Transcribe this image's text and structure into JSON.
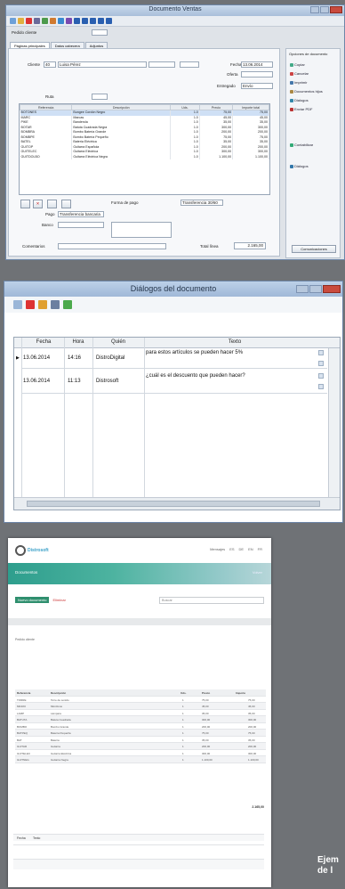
{
  "win1": {
    "title": "Documento Ventas",
    "toolbar_icons": [
      "new-icon",
      "open-icon",
      "save-icon",
      "delete-icon",
      "print-icon",
      "copy-icon",
      "mail-icon",
      "chart-icon",
      "calc-icon",
      "grid-icon",
      "blue-box-icon",
      "blue-box-icon",
      "blue-box-icon",
      "blue-box-icon"
    ],
    "customer_label": "Pedido cliente",
    "tabs": [
      "Páginas principales",
      "Datos cabecera",
      "Adjuntos"
    ],
    "client_label": "Cliente",
    "client_code": "40",
    "client_name": "Luisa Pérez",
    "fecha_label": "Fecha",
    "fecha_value": "13.06.2014",
    "oferta_label": "Oferta",
    "entregado_label": "Entregado",
    "entregado_value": "Envío",
    "ruta_label": "Ruta",
    "grid": {
      "headers": [
        "Referencia",
        "Descripción",
        "Uds.",
        "Precio",
        "Importe",
        "Importe total"
      ],
      "rows": [
        [
          "BOTONES",
          "Bungee Cordón Negro",
          "1.0",
          "75,00",
          "75,00"
        ],
        [
          "MARC",
          "Marcas",
          "1.0",
          "45,00",
          "45,00"
        ],
        [
          "PIKE",
          "Banderola",
          "1.0",
          "35,00",
          "35,00"
        ],
        [
          "BOTAR",
          "Batuta Cuadrada Negra",
          "1.0",
          "300,00",
          "300,00"
        ],
        [
          "BOMBRA",
          "Bombo Batería Grande",
          "1.0",
          "200,00",
          "200,00"
        ],
        [
          "BOMBPE",
          "Bombo Batería Pequeño",
          "1.0",
          "75,00",
          "75,00"
        ],
        [
          "BATEL",
          "Batería Eléctrica",
          "1.0",
          "35,00",
          "35,00"
        ],
        [
          "GUITOP",
          "Guitarra Española",
          "1.0",
          "200,00",
          "200,00"
        ],
        [
          "GUITELEC",
          "Guitarra Eléctrica",
          "1.0",
          "300,00",
          "300,00"
        ],
        [
          "GUITDOLBO",
          "Guitarra Eléctrica Negra",
          "1.0",
          "1.100,00",
          "1.100,00"
        ]
      ]
    },
    "forma_label": "Forma de pago",
    "forma_value": "Transferencia 30/60",
    "pago_label": "Pago",
    "pago_value": "Transferencia bancaria",
    "banco_label": "Banco",
    "comentario_label": "Comentarios",
    "total_label": "Total línea",
    "total_value": "2.165,00",
    "side_header": "Opciones de documento",
    "side_items": [
      "Copiar",
      "Cancelar",
      "Imprimir",
      "Documentos hijos",
      "Dialogos",
      "Enviar PDF",
      "Contabilizar",
      "Diálogos"
    ],
    "side_button": "Comunicaciones"
  },
  "win2": {
    "title": "Diálogos del documento",
    "toolbar_icons": [
      "doc-icon",
      "delete-icon",
      "people-icon",
      "printer-icon",
      "refresh-icon"
    ],
    "headers": [
      "Fecha",
      "Hora",
      "Quién",
      "Texto"
    ],
    "rows": [
      {
        "fecha": "13.06.2014",
        "hora": "14:16",
        "quien": "DistroDigital",
        "texto": "para estos artículos se pueden hacer 5%"
      },
      {
        "fecha": "13.06.2014",
        "hora": "11:13",
        "quien": "Distrosoft",
        "texto": "¿cuál es el descuento que pueden hacer?"
      }
    ]
  },
  "web": {
    "logo_text": "Distrosoft",
    "top_menu": [
      "Mensajes",
      "ES",
      "DE",
      "EN",
      "FR"
    ],
    "band_label": "Documentos",
    "band_right": "Volver",
    "action_button": "Nuevo documento",
    "action_link": "Eliminar",
    "search_placeholder": "Buscar",
    "header_small": "Pedido cliente",
    "table_headers": [
      "Referencia",
      "Descripción",
      "Uds.",
      "Precio",
      "Importe"
    ],
    "table_rows": [
      [
        "TORRE",
        "Torre de sonido",
        "1",
        "75,00",
        "75,00"
      ],
      [
        "MICRO",
        "Micrófono",
        "1",
        "45,00",
        "45,00"
      ],
      [
        "LAMP",
        "Lámpara",
        "1",
        "35,00",
        "35,00"
      ],
      [
        "BATUTA",
        "Batuta Cuadrada",
        "1",
        "300,00",
        "300,00"
      ],
      [
        "BOMBO",
        "Bombo Grande",
        "1",
        "200,00",
        "200,00"
      ],
      [
        "BATPEQ",
        "Batería Pequeña",
        "1",
        "75,00",
        "75,00"
      ],
      [
        "BAT",
        "Batería",
        "1",
        "35,00",
        "35,00"
      ],
      [
        "GUITAR",
        "Guitarra",
        "1",
        "200,00",
        "200,00"
      ],
      [
        "GUITELEC",
        "Guitarra Eléctrica",
        "1",
        "300,00",
        "300,00"
      ],
      [
        "GUITNEG",
        "Guitarra Negra",
        "1",
        "1.100,00",
        "1.100,00"
      ]
    ],
    "total_value": "2.165,00",
    "foot_header": [
      "Fecha",
      "Texto"
    ]
  },
  "caption": [
    "Ejem",
    "de l"
  ]
}
